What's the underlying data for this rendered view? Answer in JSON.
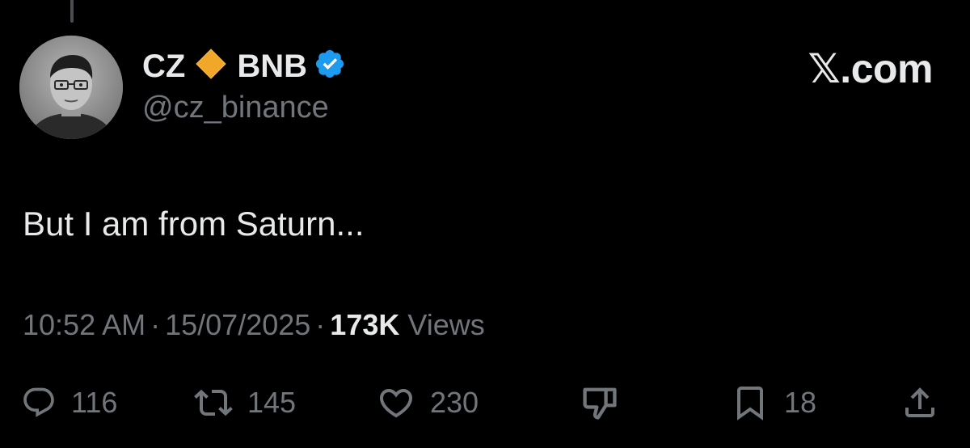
{
  "post": {
    "author": {
      "name_first": "CZ",
      "name_second": "BNB",
      "handle": "@cz_binance",
      "diamond_color": "#f0a72a",
      "verified_color": "#1d9bf0"
    },
    "source_badge": "𝕏.com",
    "text": "But I am from Saturn...",
    "time": "10:52 AM",
    "date": "15/07/2025",
    "views_count": "173K",
    "views_label": "Views",
    "separator": "·"
  },
  "actions": {
    "replies": "116",
    "reposts": "145",
    "likes": "230",
    "bookmarks": "18",
    "icons": [
      "reply-icon",
      "repost-icon",
      "like-icon",
      "dislike-icon",
      "bookmark-icon",
      "share-icon"
    ]
  },
  "theme": {
    "background": "#000000",
    "text_primary": "#e7e9ea",
    "text_secondary": "#71767b"
  }
}
